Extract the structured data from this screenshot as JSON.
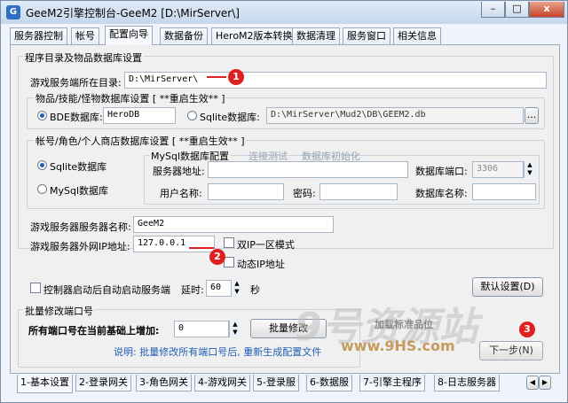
{
  "window": {
    "title": "GeeM2引擎控制台-GeeM2 [D:\\MirServer\\]",
    "icon": "app-icon",
    "min_label": "–",
    "max_label": "□",
    "close_label": "x"
  },
  "top_tabs": [
    "服务器控制",
    "帐号",
    "配置向导",
    "数据备份",
    "HeroM2版本转换",
    "数据清理",
    "服务窗口",
    "相关信息"
  ],
  "active_top_tab": "配置向导",
  "section1": {
    "title": "程序目录及物品数据库设置",
    "server_dir_label": "游戏服务端所在目录:",
    "server_dir_value": "D:\\MirServer\\",
    "db_group_title": "物品/技能/怪物数据库设置 [ **重启生效** ]",
    "bde_label": "BDE数据库:",
    "bde_value": "HeroDB",
    "sqlite_label": "Sqlite数据库:",
    "sqlite_value": "D:\\MirServer\\Mud2\\DB\\GEEM2.db",
    "browse_label": "...",
    "bde_selected": true
  },
  "account": {
    "title": "帐号/角色/个人商店数据库设置 [ **重启生效** ]",
    "sqlite_label": "Sqlite数据库",
    "mysql_label": "MySql数据库",
    "sqlite_selected": true,
    "mysql_group_title": "MySql数据库配置",
    "connect_test": "连接测试",
    "db_init": "数据库初始化",
    "server_addr_label": "服务器地址:",
    "server_addr_value": "",
    "port_label": "数据库端口:",
    "port_value": "3306",
    "user_label": "用户名称:",
    "user_value": "",
    "password_label": "密码:",
    "password_value": "",
    "dbname_label": "数据库名称:",
    "dbname_value": ""
  },
  "server": {
    "name_label": "游戏服务器服务器名称:",
    "name_value": "GeeM2",
    "ip_label": "游戏服务器外网IP地址:",
    "ip_value": "127.0.0.1",
    "dual_ip_label": "双IP一区模式",
    "dynamic_ip_label": "动态IP地址",
    "autostart_label": "控制器启动后自动启动服务端",
    "delay_label": "延时:",
    "delay_value": "60",
    "seconds_label": "秒",
    "default_button": "默认设置(D)"
  },
  "batch": {
    "title": "批量修改端口号",
    "add_label": "所有端口号在当前基础上增加:",
    "add_value": "0",
    "button": "批量修改",
    "note": "说明: 批量修改所有端口号后, 重新生成配置文件"
  },
  "annotations": {
    "badge1": "1",
    "badge2": "2",
    "badge3": "3",
    "color": "#e02020"
  },
  "bottom_tabs": [
    "1-基本设置",
    "2-登录网关",
    "3-角色网关",
    "4-游戏网关",
    "5-登录服",
    "6-数据服",
    "7-引擎主程序",
    "8-日志服务器"
  ],
  "active_bottom_tab": "1-基本设置",
  "watermark": {
    "line1": "9号资源站",
    "line2": "www.9HS.com",
    "line3": "加载标准品位",
    "line4": "下一步(N)"
  }
}
